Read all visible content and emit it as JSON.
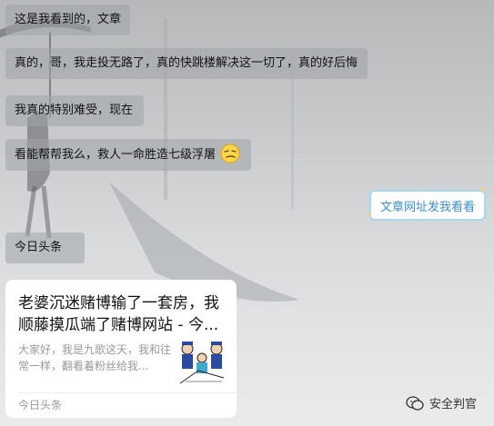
{
  "messages": [
    {
      "text": "这是我看到的，文章"
    },
    {
      "text": "真的，哥，我走投无路了，真的快跳楼解决这一切了，真的好后悔"
    },
    {
      "text": "我真的特别难受，现在"
    },
    {
      "text": "看能帮帮我么，救人一命胜造七级浮屠",
      "emoji": "smirk-face-emoji"
    },
    {
      "text": "今日头条"
    }
  ],
  "reply": {
    "text": "文章网址发我看看"
  },
  "article_card": {
    "title": "老婆沉迷赌博输了一套房，我顺藤摸瓜端了赌博网站 - 今...",
    "description": "大家好，我是九歌这天，我和往常一样，翻看着粉丝给我...",
    "thumbnail": "police-cartoon-thumbnail",
    "source": "今日头条"
  },
  "watermark": {
    "text": "安全判官",
    "icon": "wechat-official-account-icon"
  },
  "colors": {
    "reply_text": "#3b8fd1",
    "reply_border": "#a8d8f5",
    "left_bubble": "#a0a4a8"
  }
}
